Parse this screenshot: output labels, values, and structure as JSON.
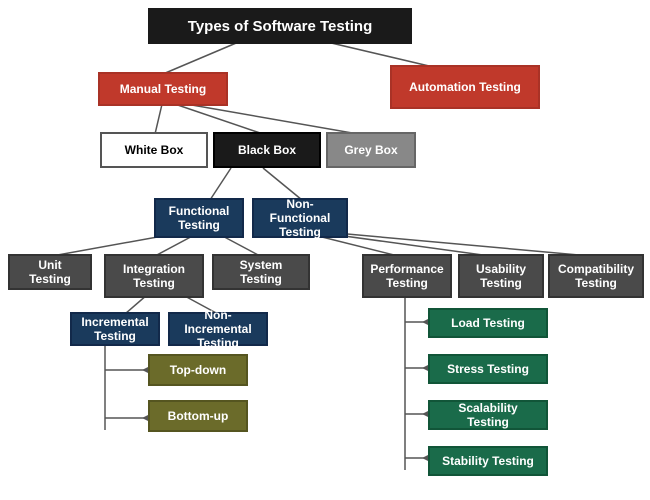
{
  "title": "Types of Software Testing",
  "nodes": {
    "title": "Types of Software Testing",
    "manual": "Manual Testing",
    "automation": "Automation Testing",
    "whitebox": "White Box",
    "blackbox": "Black Box",
    "greybox": "Grey Box",
    "functional": "Functional Testing",
    "nonfunctional": "Non-Functional Testing",
    "unit": "Unit Testing",
    "integration": "Integration Testing",
    "system": "System Testing",
    "performance": "Performance Testing",
    "usability": "Usability Testing",
    "compatibility": "Compatibility Testing",
    "incremental": "Incremental Testing",
    "nonincremental": "Non-Incremental Testing",
    "topdown": "Top-down",
    "bottomup": "Bottom-up",
    "load": "Load Testing",
    "stress": "Stress Testing",
    "scalability": "Scalability Testing",
    "stability": "Stability Testing"
  }
}
